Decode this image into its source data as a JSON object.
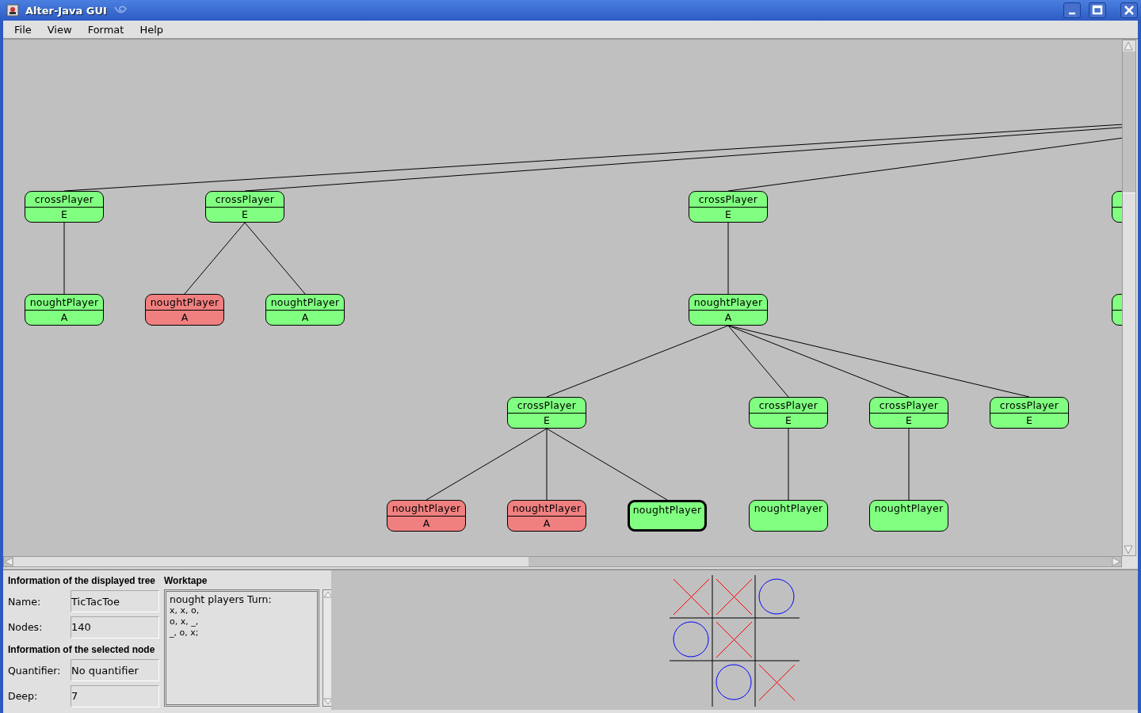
{
  "window": {
    "title": "Alter-Java GUI"
  },
  "menu": [
    {
      "label": "File"
    },
    {
      "label": "View"
    },
    {
      "label": "Format"
    },
    {
      "label": "Help"
    }
  ],
  "tree": {
    "nodes": [
      {
        "label": "crossPlayer",
        "quantifier": "E",
        "color": "#80ff80",
        "selected": false,
        "children": [
          {
            "label": "noughtPlayer",
            "quantifier": "A",
            "color": "#80ff80",
            "selected": false
          }
        ]
      },
      {
        "label": "crossPlayer",
        "quantifier": "E",
        "color": "#80ff80",
        "selected": false,
        "children": [
          {
            "label": "noughtPlayer",
            "quantifier": "A",
            "color": "#f08080",
            "selected": false
          },
          {
            "label": "noughtPlayer",
            "quantifier": "A",
            "color": "#80ff80",
            "selected": false
          }
        ]
      },
      {
        "label": "crossPlayer",
        "quantifier": "E",
        "color": "#80ff80",
        "selected": false,
        "children": [
          {
            "label": "noughtPlayer",
            "quantifier": "A",
            "color": "#80ff80",
            "selected": false,
            "children": [
              {
                "label": "crossPlayer",
                "quantifier": "E",
                "color": "#80ff80",
                "selected": false,
                "children": [
                  {
                    "label": "noughtPlayer",
                    "quantifier": "A",
                    "color": "#f08080",
                    "selected": false
                  },
                  {
                    "label": "noughtPlayer",
                    "quantifier": "A",
                    "color": "#f08080",
                    "selected": false
                  },
                  {
                    "label": "noughtPlayer",
                    "color": "#80ff80",
                    "selected": true
                  }
                ]
              },
              {
                "label": "crossPlayer",
                "quantifier": "E",
                "color": "#80ff80",
                "selected": false,
                "children": [
                  {
                    "label": "noughtPlayer",
                    "color": "#80ff80",
                    "selected": false
                  }
                ]
              },
              {
                "label": "crossPlayer",
                "quantifier": "E",
                "color": "#80ff80",
                "selected": false,
                "children": [
                  {
                    "label": "noughtPlayer",
                    "color": "#80ff80",
                    "selected": false
                  }
                ]
              },
              {
                "label": "crossPlayer",
                "quantifier": "E",
                "color": "#80ff80",
                "selected": false
              }
            ]
          }
        ]
      },
      {
        "color": "#80ff80",
        "selected": false,
        "children": [
          {
            "color": "#80ff80",
            "selected": false
          }
        ]
      }
    ]
  },
  "tree_info": {
    "heading": "Information of the displayed tree",
    "fields": [
      {
        "label": "Name:",
        "value": "TicTacToe"
      },
      {
        "label": "Nodes:",
        "value": "140"
      }
    ]
  },
  "node_info": {
    "heading": "Information of the selected node",
    "fields": [
      {
        "label": "Quantifier:",
        "value": "No quantifier"
      },
      {
        "label": "Deep:",
        "value": "7"
      }
    ]
  },
  "worktape": {
    "heading": "Worktape",
    "lines": [
      "nought players Turn:",
      "x, x, o,",
      "o, x, _,",
      "_, o, x;"
    ]
  },
  "board": [
    {
      "kind": "cross"
    },
    {
      "kind": "cross"
    },
    {
      "kind": "nought"
    },
    {
      "kind": "nought"
    },
    {
      "kind": "cross"
    },
    {
      "kind": "empty"
    },
    {
      "kind": "empty"
    },
    {
      "kind": "nought"
    },
    {
      "kind": "cross"
    }
  ]
}
